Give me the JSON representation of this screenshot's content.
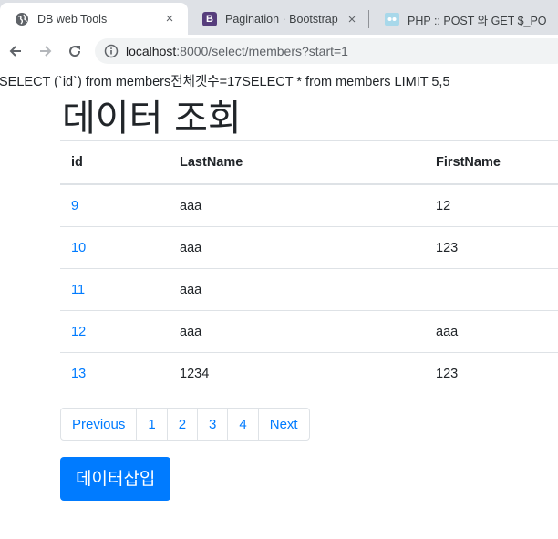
{
  "browser": {
    "tabs": [
      {
        "title": "DB web Tools",
        "icon": "globe-icon",
        "active": true
      },
      {
        "title": "Pagination · Bootstrap",
        "icon": "bootstrap-icon",
        "active": false
      },
      {
        "title": "PHP :: POST 와 GET $_PO",
        "icon": "php-icon",
        "active": false
      }
    ],
    "close_glyph": "×",
    "bootstrap_glyph": "B",
    "url_host": "localhost",
    "url_rest": ":8000/select/members?start=1"
  },
  "page": {
    "debug_line": "SELECT (`id`) from members전체갯수=17SELECT * from members LIMIT 5,5",
    "title": "데이터 조회",
    "table": {
      "headers": [
        "id",
        "LastName",
        "FirstName"
      ],
      "rows": [
        {
          "id": "9",
          "last": "aaa",
          "first": "12"
        },
        {
          "id": "10",
          "last": "aaa",
          "first": "123"
        },
        {
          "id": "11",
          "last": "aaa",
          "first": ""
        },
        {
          "id": "12",
          "last": "aaa",
          "first": "aaa"
        },
        {
          "id": "13",
          "last": "1234",
          "first": "123"
        }
      ]
    },
    "pagination": [
      "Previous",
      "1",
      "2",
      "3",
      "4",
      "Next"
    ],
    "insert_button": "데이터삽입"
  },
  "colors": {
    "link": "#007bff",
    "primary": "#007bff"
  }
}
